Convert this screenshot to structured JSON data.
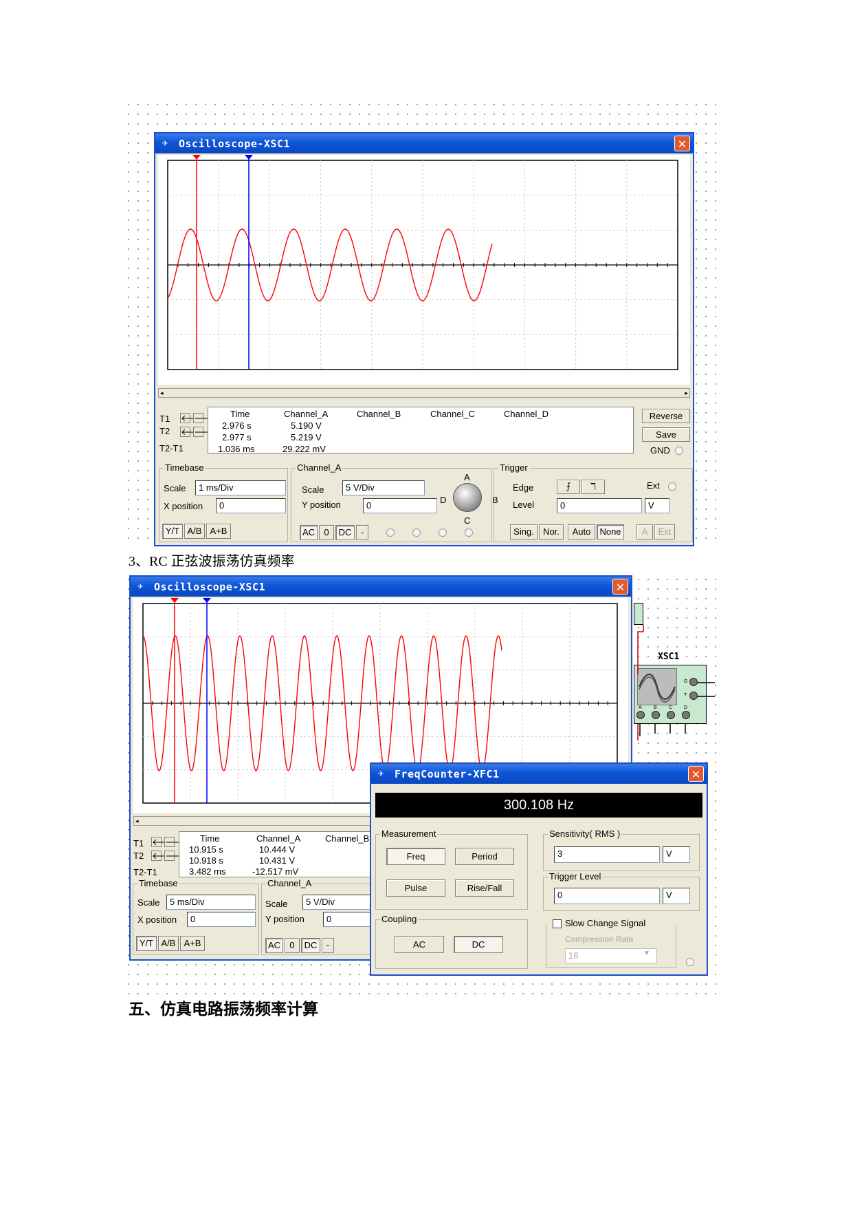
{
  "captions": {
    "section_3": "3、RC 正弦波振荡仿真频率",
    "section_5": "五、仿真电路振荡频率计算"
  },
  "osc1": {
    "title": "Oscilloscope-XSC1",
    "close": "✕",
    "readout": {
      "headers": [
        "Time",
        "Channel_A",
        "Channel_B",
        "Channel_C",
        "Channel_D"
      ],
      "rows": [
        {
          "label": "T1",
          "time": "2.976 s",
          "channel_a": "5.190 V"
        },
        {
          "label": "T2",
          "time": "2.977 s",
          "channel_a": "5.219 V"
        },
        {
          "label": "T2-T1",
          "time": "1.036 ms",
          "channel_a": "29.222 mV"
        }
      ]
    },
    "right_buttons": {
      "reverse": "Reverse",
      "save": "Save",
      "gnd": "GND"
    },
    "timebase": {
      "label": "Timebase",
      "scale_label": "Scale",
      "scale": "1 ms/Div",
      "xpos_label": "X position",
      "xpos": "0",
      "modes": [
        "Y/T",
        "A/B",
        "A+B"
      ]
    },
    "channel": {
      "label": "Channel_A",
      "scale_label": "Scale",
      "scale": "5  V/Div",
      "ypos_label": "Y position",
      "ypos": "0",
      "coupling": [
        "AC",
        "0",
        "DC",
        "-"
      ],
      "knob": {
        "a": "A",
        "b": "B",
        "c": "C",
        "d": "D"
      }
    },
    "trigger": {
      "label": "Trigger",
      "edge_label": "Edge",
      "level_label": "Level",
      "level": "0",
      "unit": "V",
      "ext": "Ext",
      "modes": [
        "Sing.",
        "Nor.",
        "Auto",
        "None"
      ],
      "src": [
        "A",
        "Ext"
      ]
    },
    "colors": {
      "trace": "#ff0000",
      "cursor1": "#ff0000",
      "cursor2": "#0000ff"
    }
  },
  "osc2": {
    "title": "Oscilloscope-XSC1",
    "close": "✕",
    "readout": {
      "headers": [
        "Time",
        "Channel_A",
        "Channel_B"
      ],
      "rows": [
        {
          "label": "T1",
          "time": "10.915 s",
          "channel_a": "10.444 V"
        },
        {
          "label": "T2",
          "time": "10.918 s",
          "channel_a": "10.431 V"
        },
        {
          "label": "T2-T1",
          "time": "3.482 ms",
          "channel_a": "-12.517 mV"
        }
      ]
    },
    "timebase": {
      "label": "Timebase",
      "scale_label": "Scale",
      "scale": "5 ms/Div",
      "xpos_label": "X position",
      "xpos": "0",
      "modes": [
        "Y/T",
        "A/B",
        "A+B"
      ]
    },
    "channel": {
      "label": "Channel_A",
      "scale_label": "Scale",
      "scale": "5  V/Div",
      "ypos_label": "Y position",
      "ypos": "0",
      "coupling": [
        "AC",
        "0",
        "DC",
        "-"
      ]
    }
  },
  "instrument": {
    "name": "XSC1",
    "pins": [
      "A",
      "B",
      "C",
      "D"
    ],
    "side_pins": [
      "G",
      "T"
    ]
  },
  "freq": {
    "title": "FreqCounter-XFC1",
    "close": "✕",
    "display": "300.108 Hz",
    "measurement": {
      "label": "Measurement",
      "buttons": [
        "Freq",
        "Period",
        "Pulse",
        "Rise/Fall"
      ]
    },
    "coupling": {
      "label": "Coupling",
      "buttons": [
        "AC",
        "DC"
      ]
    },
    "sensitivity": {
      "label": "Sensitivity( RMS )",
      "value": "3",
      "unit": "V"
    },
    "trigger_level": {
      "label": "Trigger Level",
      "value": "0",
      "unit": "V"
    },
    "slow_change": {
      "label": "Slow Change Signal",
      "compression_label": "Compression Rate",
      "compression_value": "16"
    }
  }
}
